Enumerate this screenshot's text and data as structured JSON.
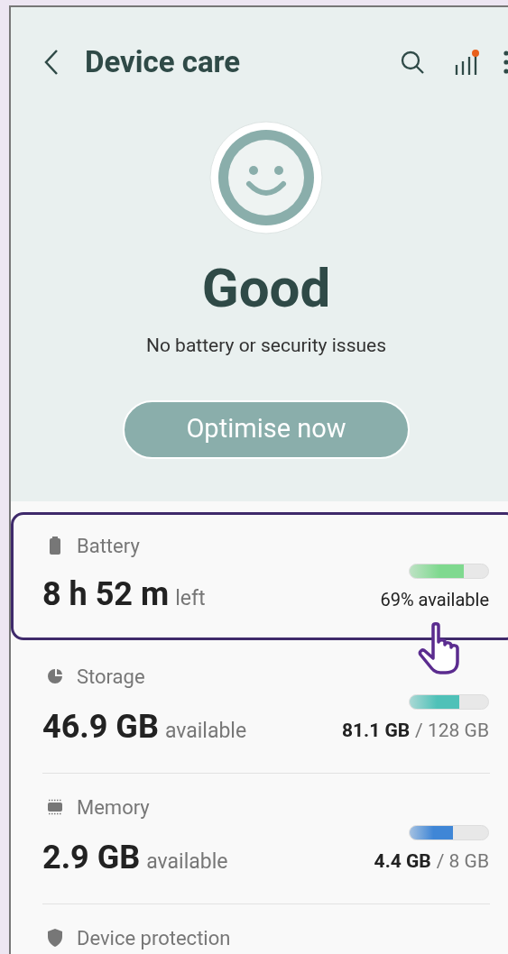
{
  "header": {
    "title": "Device care"
  },
  "status": {
    "title": "Good",
    "subtitle": "No battery or security issues",
    "button": "Optimise now"
  },
  "items": [
    {
      "kind": "battery",
      "label": "Battery",
      "value": "8 h 52 m",
      "unit": "left",
      "level": 0.69,
      "color": "#7fd98f",
      "detail": "69% available",
      "selected": true
    },
    {
      "kind": "storage",
      "label": "Storage",
      "value": "46.9 GB",
      "unit": "available",
      "level": 0.63,
      "color": "#4fc1b8",
      "used": "81.1 GB",
      "total": "/ 128 GB",
      "selected": false
    },
    {
      "kind": "memory",
      "label": "Memory",
      "value": "2.9 GB",
      "unit": "available",
      "level": 0.55,
      "color": "#3f86d6",
      "used": "4.4 GB",
      "total": "/ 8 GB",
      "selected": false
    },
    {
      "kind": "protection",
      "label": "Device protection",
      "selected": false
    }
  ]
}
